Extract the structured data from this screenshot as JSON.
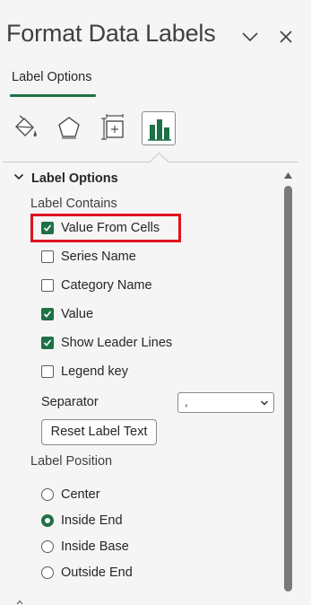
{
  "pane": {
    "title": "Format Data Labels",
    "collapse_icon": "chevron-down-icon",
    "close_icon": "close-icon"
  },
  "tabs": [
    {
      "label": "Label Options",
      "active": true
    }
  ],
  "category_icons": [
    {
      "name": "fill-line-icon",
      "selected": false
    },
    {
      "name": "effects-icon",
      "selected": false
    },
    {
      "name": "size-properties-icon",
      "selected": false
    },
    {
      "name": "label-options-icon",
      "selected": true
    }
  ],
  "label_options": {
    "heading": "Label Options",
    "label_contains": {
      "heading": "Label Contains",
      "items": [
        {
          "label": "Value From Cells",
          "checked": true,
          "highlighted": true
        },
        {
          "label": "Series Name",
          "checked": false
        },
        {
          "label": "Category Name",
          "checked": false
        },
        {
          "label": "Value",
          "checked": true
        },
        {
          "label": "Show Leader Lines",
          "checked": true
        },
        {
          "label": "Legend key",
          "checked": false
        }
      ]
    },
    "separator": {
      "label": "Separator",
      "value": ","
    },
    "reset_button": "Reset Label Text",
    "label_position": {
      "heading": "Label Position",
      "options": [
        {
          "label": "Center",
          "selected": false
        },
        {
          "label": "Inside End",
          "selected": true
        },
        {
          "label": "Inside Base",
          "selected": false
        },
        {
          "label": "Outside End",
          "selected": false
        }
      ]
    }
  },
  "colors": {
    "accent": "#1e7145",
    "highlight": "#e0121e",
    "background": "#f5f5f5"
  }
}
